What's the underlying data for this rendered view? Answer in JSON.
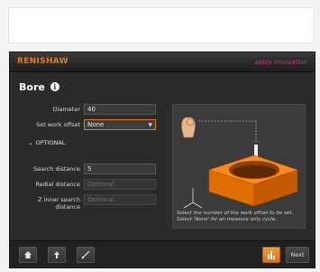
{
  "header": {
    "logo": "RENISHAW",
    "brand_mark": "apply innovation"
  },
  "page": {
    "title": "Bore"
  },
  "form": {
    "diameter": {
      "label": "Diameter",
      "value": "40"
    },
    "work_offset": {
      "label": "Set work offset",
      "value": "None"
    },
    "optional_label": "OPTIONAL",
    "search_distance": {
      "label": "Search distance",
      "value": "5"
    },
    "radial_distance": {
      "label": "Radial distance",
      "placeholder": "Optional"
    },
    "z_inner_search": {
      "label": "Z inner search distance",
      "placeholder": "Optional"
    }
  },
  "preview": {
    "hint": "Select the number of the work offset to be set. Select 'None' for an measure only cycle."
  },
  "footer": {
    "home_icon": "home-icon",
    "up_icon": "arrow-up-icon",
    "probe_icon": "probe-icon",
    "results_icon": "results-icon",
    "next_label": "Next"
  }
}
